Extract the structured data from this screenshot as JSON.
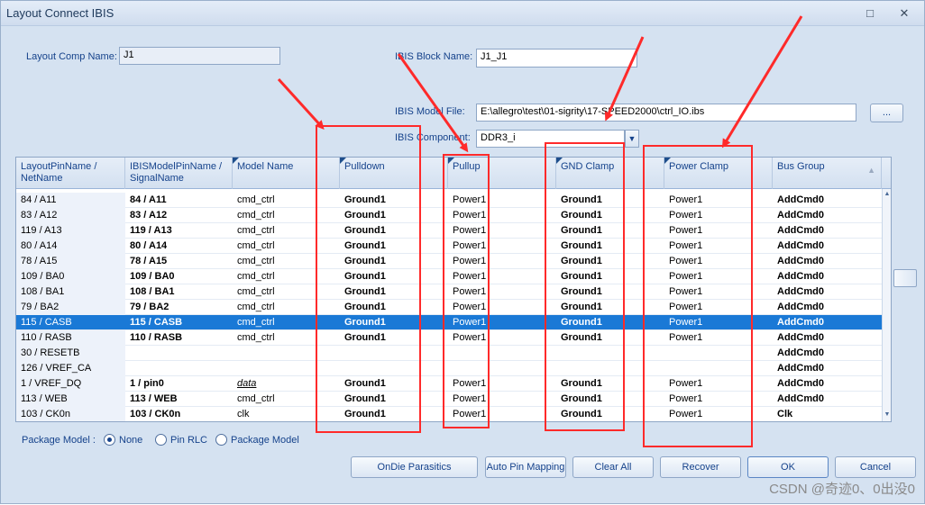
{
  "window": {
    "title": "Layout Connect IBIS",
    "maximize_icon": "maximize-icon",
    "close_icon": "close-icon"
  },
  "form": {
    "layout_comp_name_label": "Layout Comp Name:",
    "layout_comp_name_value": "J1",
    "ibis_block_name_label": "IBIS Block Name:",
    "ibis_block_name_value": "J1_J1",
    "ibis_model_file_label": "IBIS Model File:",
    "ibis_model_file_value": "E:\\allegro\\test\\01-sigrity\\17-SPEED2000\\ctrl_IO.ibs",
    "browse_label": "...",
    "ibis_component_label": "IBIS Component:",
    "ibis_component_value": "DDR3_i"
  },
  "grid": {
    "columns": [
      {
        "label": "LayoutPinName /\nNetName"
      },
      {
        "label": "IBISModelPinName /\nSignalName"
      },
      {
        "label": "Model Name"
      },
      {
        "label": "Pulldown"
      },
      {
        "label": "Pullup"
      },
      {
        "label": "GND Clamp"
      },
      {
        "label": "Power Clamp"
      },
      {
        "label": "Bus Group"
      }
    ],
    "rows": [
      {
        "pin": "84 / A11",
        "ibis": "84 / A11",
        "model": "cmd_ctrl",
        "pulldown": "Ground1",
        "pullup": "Power1",
        "gnd": "Ground1",
        "pwr": "Power1",
        "bus": "AddCmd0"
      },
      {
        "pin": "83 / A12",
        "ibis": "83 / A12",
        "model": "cmd_ctrl",
        "pulldown": "Ground1",
        "pullup": "Power1",
        "gnd": "Ground1",
        "pwr": "Power1",
        "bus": "AddCmd0"
      },
      {
        "pin": "119 / A13",
        "ibis": "119 / A13",
        "model": "cmd_ctrl",
        "pulldown": "Ground1",
        "pullup": "Power1",
        "gnd": "Ground1",
        "pwr": "Power1",
        "bus": "AddCmd0"
      },
      {
        "pin": "80 / A14",
        "ibis": "80 / A14",
        "model": "cmd_ctrl",
        "pulldown": "Ground1",
        "pullup": "Power1",
        "gnd": "Ground1",
        "pwr": "Power1",
        "bus": "AddCmd0"
      },
      {
        "pin": "78 / A15",
        "ibis": "78 / A15",
        "model": "cmd_ctrl",
        "pulldown": "Ground1",
        "pullup": "Power1",
        "gnd": "Ground1",
        "pwr": "Power1",
        "bus": "AddCmd0"
      },
      {
        "pin": "109 / BA0",
        "ibis": "109 / BA0",
        "model": "cmd_ctrl",
        "pulldown": "Ground1",
        "pullup": "Power1",
        "gnd": "Ground1",
        "pwr": "Power1",
        "bus": "AddCmd0"
      },
      {
        "pin": "108 / BA1",
        "ibis": "108 / BA1",
        "model": "cmd_ctrl",
        "pulldown": "Ground1",
        "pullup": "Power1",
        "gnd": "Ground1",
        "pwr": "Power1",
        "bus": "AddCmd0"
      },
      {
        "pin": "79 / BA2",
        "ibis": "79 / BA2",
        "model": "cmd_ctrl",
        "pulldown": "Ground1",
        "pullup": "Power1",
        "gnd": "Ground1",
        "pwr": "Power1",
        "bus": "AddCmd0"
      },
      {
        "pin": "115 / CASB",
        "ibis": "115 / CASB",
        "model": "cmd_ctrl",
        "pulldown": "Ground1",
        "pullup": "Power1",
        "gnd": "Ground1",
        "pwr": "Power1",
        "bus": "AddCmd0"
      },
      {
        "pin": "110 / RASB",
        "ibis": "110 / RASB",
        "model": "cmd_ctrl",
        "pulldown": "Ground1",
        "pullup": "Power1",
        "gnd": "Ground1",
        "pwr": "Power1",
        "bus": "AddCmd0"
      },
      {
        "pin": "30 / RESETB",
        "ibis": "",
        "model": "",
        "pulldown": "",
        "pullup": "",
        "gnd": "",
        "pwr": "",
        "bus": "AddCmd0"
      },
      {
        "pin": "126 / VREF_CA",
        "ibis": "",
        "model": "",
        "pulldown": "",
        "pullup": "",
        "gnd": "",
        "pwr": "",
        "bus": "AddCmd0"
      },
      {
        "pin": "1 / VREF_DQ",
        "ibis": "1 / pin0",
        "model": "data",
        "pulldown": "Ground1",
        "pullup": "Power1",
        "gnd": "Ground1",
        "pwr": "Power1",
        "bus": "AddCmd0"
      },
      {
        "pin": "113 / WEB",
        "ibis": "113 / WEB",
        "model": "cmd_ctrl",
        "pulldown": "Ground1",
        "pullup": "Power1",
        "gnd": "Ground1",
        "pwr": "Power1",
        "bus": "AddCmd0"
      },
      {
        "pin": "103 / CK0n",
        "ibis": "103 / CK0n",
        "model": "clk",
        "pulldown": "Ground1",
        "pullup": "Power1",
        "gnd": "Ground1",
        "pwr": "Power1",
        "bus": "Clk"
      }
    ],
    "selected_row": 8,
    "italic_model_row": 12
  },
  "package": {
    "label": "Package Model :",
    "options": [
      "None",
      "Pin RLC",
      "Package Model"
    ],
    "selected": "None"
  },
  "buttons": {
    "ondie": "OnDie Parasitics",
    "autopin": "Auto Pin Mapping",
    "clear": "Clear All",
    "recover": "Recover",
    "ok": "OK",
    "cancel": "Cancel"
  },
  "watermark": "CSDN @奇迹0、0出没0",
  "colors": {
    "selection": "#1a79d6",
    "annotation": "#ff2a2a",
    "header": "#15428b"
  }
}
